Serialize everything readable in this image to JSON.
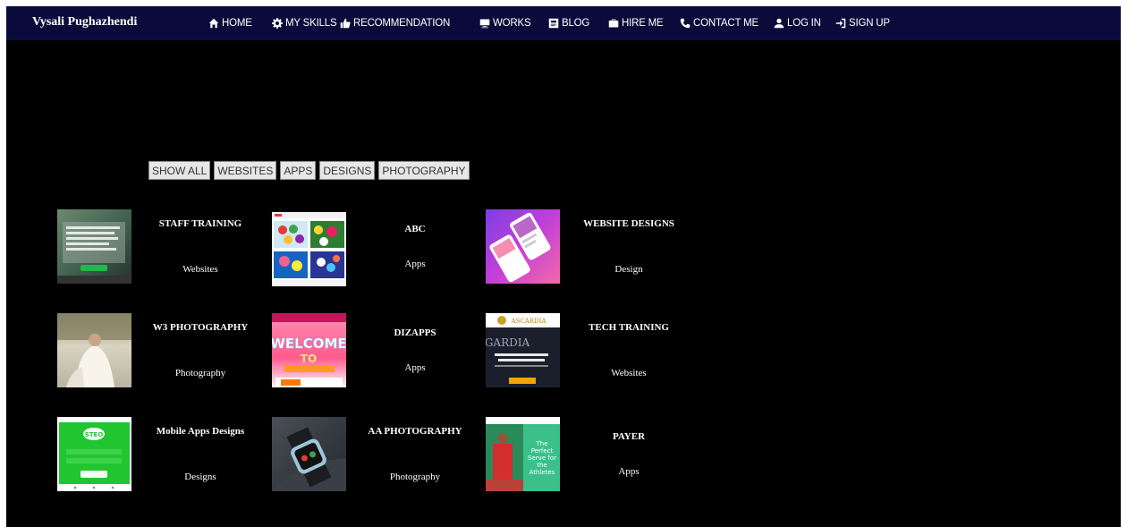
{
  "brand": "Vysali Pughazhendi",
  "nav": [
    {
      "label": "HOME",
      "icon": "home-icon"
    },
    {
      "label": "MY SKILLS",
      "icon": "gear-icon"
    },
    {
      "label": "RECOMMENDATION",
      "icon": "thumbs-up-icon"
    },
    {
      "label": "WORKS",
      "icon": "works-icon"
    },
    {
      "label": "BLOG",
      "icon": "blog-icon"
    },
    {
      "label": "HIRE ME",
      "icon": "briefcase-icon"
    },
    {
      "label": "CONTACT ME",
      "icon": "phone-icon"
    },
    {
      "label": "LOG IN",
      "icon": "user-icon"
    },
    {
      "label": "SIGN UP",
      "icon": "sign-in-icon"
    }
  ],
  "filters": [
    "SHOW ALL",
    "WEBSITES",
    "APPS",
    "DESIGNS",
    "PHOTOGRAPHY"
  ],
  "portfolio": [
    {
      "title": "STAFF TRAINING",
      "category": "Websites"
    },
    {
      "title": "ABC",
      "category": "Apps"
    },
    {
      "title": "WEBSITE DESIGNS",
      "category": "Design"
    },
    {
      "title": "W3 PHOTOGRAPHY",
      "category": "Photography"
    },
    {
      "title": "DIZAPPS",
      "category": "Apps"
    },
    {
      "title": "TECH TRAINING",
      "category": "Websites"
    },
    {
      "title": "Mobile Apps Designs",
      "category": "Designs"
    },
    {
      "title": "AA PHOTOGRAPHY",
      "category": "Photography"
    },
    {
      "title": "PAYER",
      "category": "Apps"
    }
  ],
  "thumbnail_text": {
    "ascardia_brand": "ASCARDIA",
    "ascardia_word": "GARDIA",
    "dizapps_word_1": "WELCOME",
    "dizapps_word_2": "TO",
    "payer_headline": "The Perfect Serve for the Athletes",
    "mobile_logo": "STEO"
  },
  "colors": {
    "page_background": "#000000",
    "navbar_background": "#0b0b3b",
    "text": "#ffffff",
    "filter_button_background": "#e7e7e7"
  }
}
